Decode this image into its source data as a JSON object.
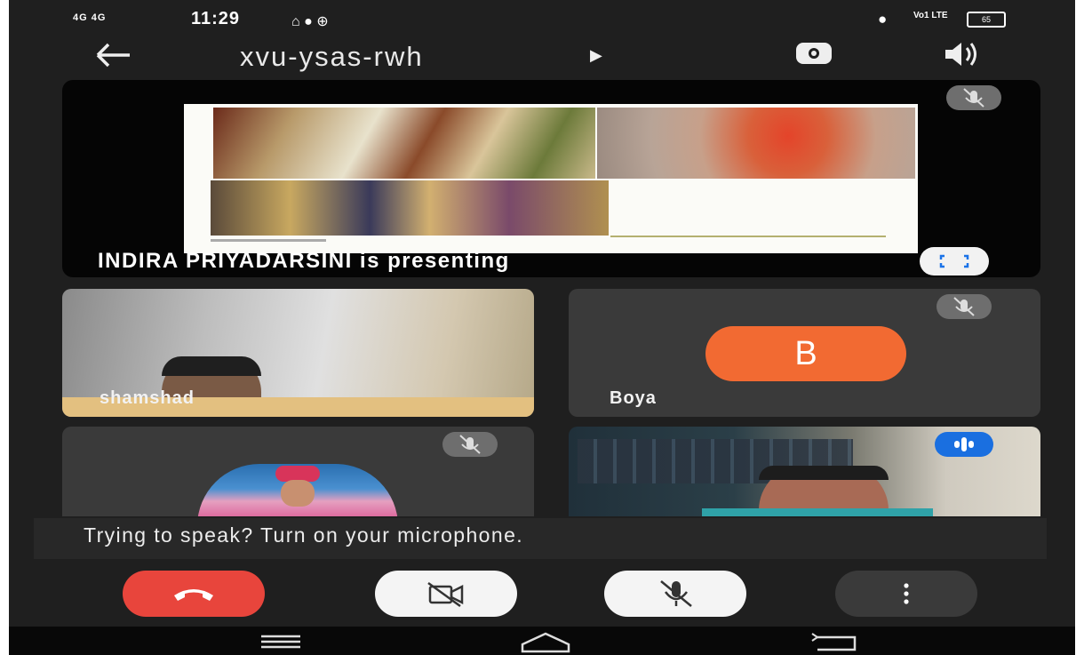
{
  "status_bar": {
    "network_left": "4G  4G",
    "time": "11:29",
    "network_right": "Vo1 LTE",
    "battery": "65"
  },
  "header": {
    "meeting_code": "xvu-ysas-rwh",
    "back_icon": "arrow-left-icon",
    "switch_camera_icon": "switch-camera-icon",
    "audio_icon": "speaker-icon"
  },
  "presentation": {
    "presenter_label": "INDIRA PRIYADARSINI is presenting",
    "fullscreen_icon": "fullscreen-icon",
    "mic_icon": "mic-off-icon"
  },
  "participants": [
    {
      "name": "shamshad",
      "has_video": true
    },
    {
      "name": "Boya",
      "avatar_letter": "B",
      "avatar_color": "#f26a32",
      "muted": true
    },
    {
      "name": "",
      "muted": true,
      "avatar": "photo"
    },
    {
      "name": "",
      "speaking": true,
      "has_video": true
    }
  ],
  "banner": {
    "text": "Trying to speak? Turn on your microphone."
  },
  "controls": {
    "end_call_color": "#e8453c",
    "end_call_icon": "phone-hangup-icon",
    "camera_icon": "camera-off-icon",
    "mic_icon": "mic-off-icon",
    "more_icon": "more-vertical-icon"
  },
  "nav": {
    "menu_icon": "menu-icon",
    "home_icon": "home-icon",
    "back_icon": "back-icon"
  }
}
